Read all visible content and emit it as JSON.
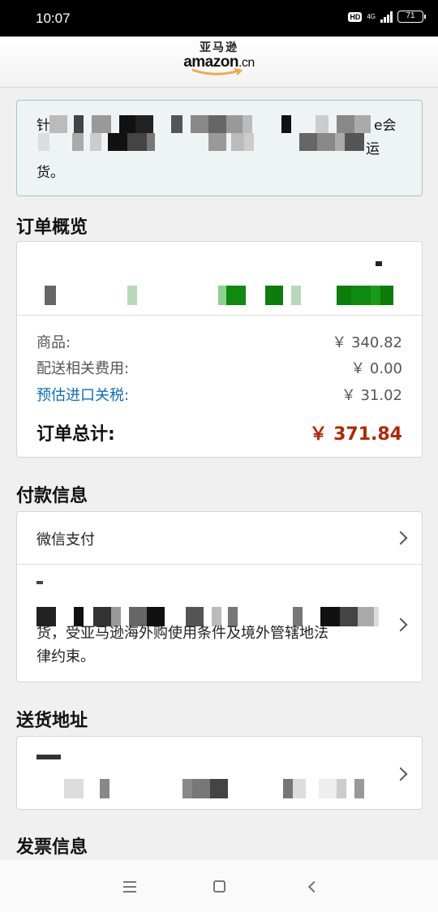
{
  "status_bar": {
    "time": "10:07",
    "hd": "HD",
    "network": "4G",
    "battery": "71"
  },
  "header": {
    "logo_cn": "亚马逊",
    "logo_en": "amazon",
    "logo_suffix": ".cn"
  },
  "notice": {
    "line1_start": "针",
    "line1_end": "e会",
    "line2_end": "运",
    "line3": "货。"
  },
  "order_summary": {
    "title": "订单概览",
    "rows": [
      {
        "label": "商品:",
        "value": "￥ 340.82"
      },
      {
        "label": "配送相关费用:",
        "value": "￥ 0.00"
      },
      {
        "label": "预估进口关税:",
        "value": "￥ 31.02"
      }
    ],
    "total_label": "订单总计:",
    "total_value": "￥ 371.84"
  },
  "payment": {
    "title": "付款信息",
    "method": "微信支付",
    "note_line3": "货，受亚马逊海外购使用条件及境外管辖地法",
    "note_line4": "律约束。"
  },
  "shipping": {
    "title": "送货地址"
  },
  "invoice": {
    "title": "发票信息"
  },
  "icons": [
    "chevron-right-icon",
    "menu-icon",
    "home-icon",
    "back-icon"
  ],
  "colors": {
    "total_red": "#b12704",
    "link_blue": "#0a6fb5",
    "notice_border": "#9fc9d0"
  }
}
